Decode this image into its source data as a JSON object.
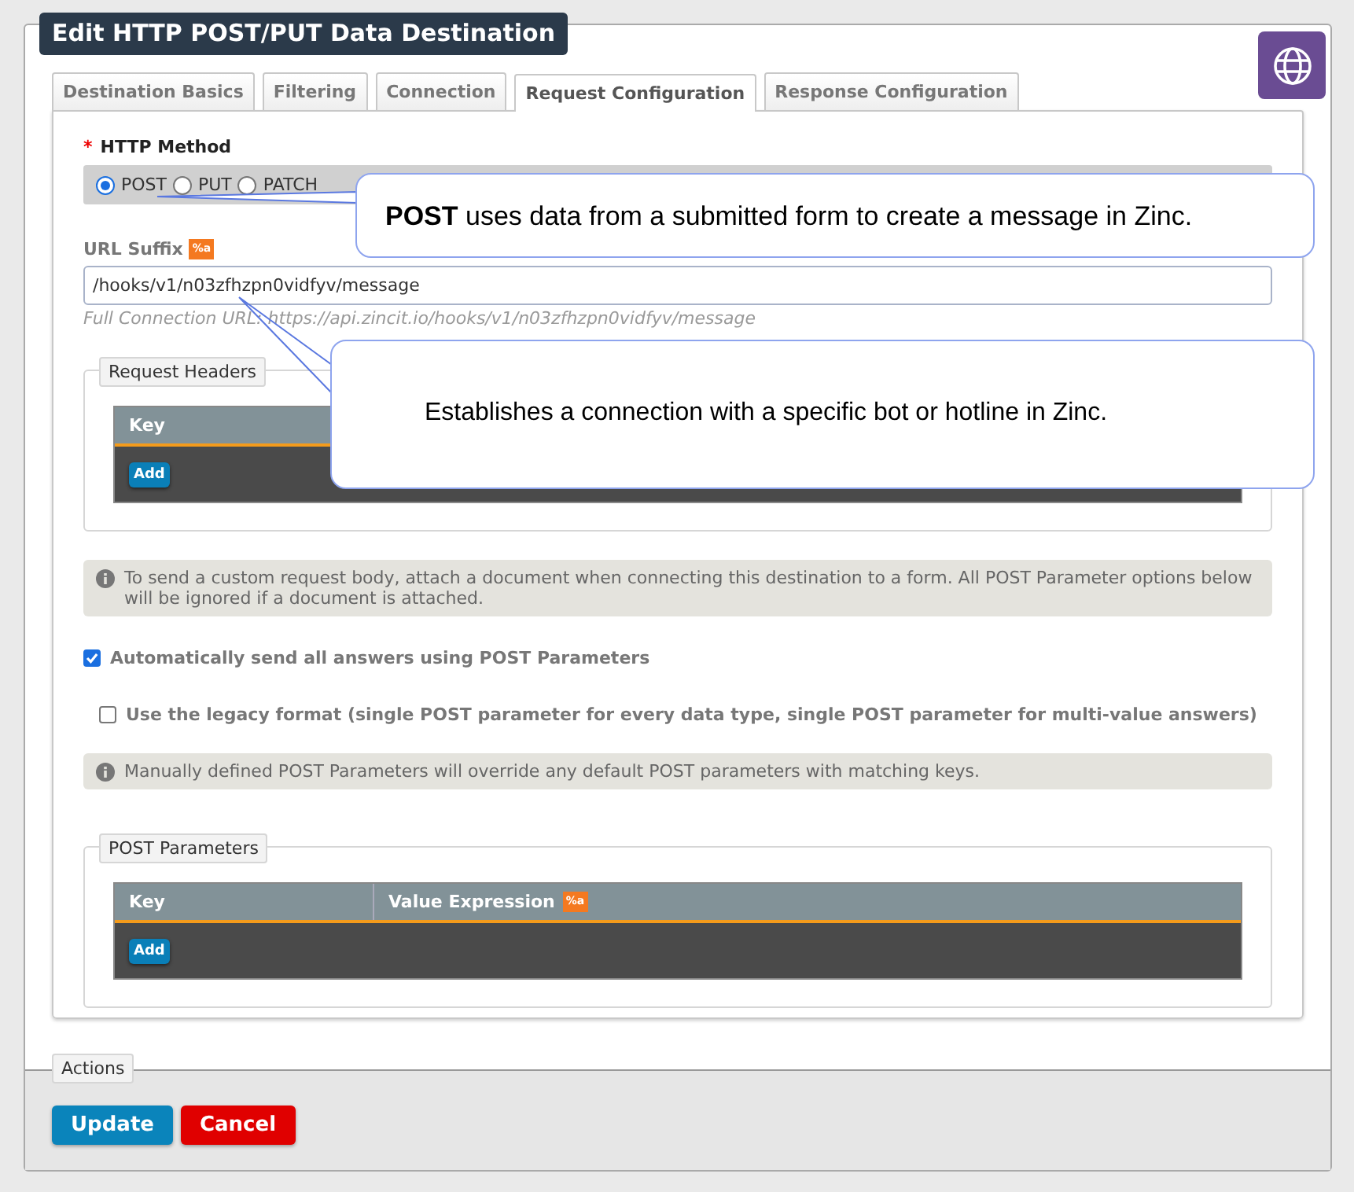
{
  "dialog": {
    "title": "Edit HTTP POST/PUT Data Destination"
  },
  "tabs": [
    {
      "label": "Destination Basics",
      "selected": false
    },
    {
      "label": "Filtering",
      "selected": false
    },
    {
      "label": "Connection",
      "selected": false
    },
    {
      "label": "Request Configuration",
      "selected": true
    },
    {
      "label": "Response Configuration",
      "selected": false
    }
  ],
  "http_method": {
    "required_mark": "*",
    "label": "HTTP Method",
    "options": [
      {
        "label": "POST",
        "selected": true
      },
      {
        "label": "PUT",
        "selected": false
      },
      {
        "label": "PATCH",
        "selected": false
      }
    ]
  },
  "url_suffix": {
    "label": "URL Suffix",
    "badge": "%a",
    "value": "/hooks/v1/n03zfhzpn0vidfyv/message",
    "hint": "Full Connection URL: https://api.zincit.io/hooks/v1/n03zfhzpn0vidfyv/message"
  },
  "request_headers": {
    "legend": "Request Headers",
    "columns": [
      {
        "label": "Key"
      }
    ],
    "add_button": "Add"
  },
  "body_note": "To send a custom request body, attach a document when connecting this destination to a form. All POST Parameter options below will be ignored if a document is attached.",
  "options": [
    {
      "label": "Automatically send all answers using POST Parameters",
      "checked": true,
      "children": [
        {
          "label": "Use the legacy format (single POST parameter for every data type, single POST parameter for multi-value answers)",
          "checked": false
        }
      ]
    }
  ],
  "override_note": "Manually defined POST Parameters will override any default POST parameters with matching keys.",
  "post_parameters": {
    "legend": "POST Parameters",
    "columns": [
      {
        "label": "Key"
      },
      {
        "label": "Value Expression",
        "badge": "%a"
      }
    ],
    "add_button": "Add"
  },
  "actions": {
    "legend": "Actions",
    "buttons": [
      {
        "label": "Update",
        "kind": "primary"
      },
      {
        "label": "Cancel",
        "kind": "danger"
      }
    ]
  },
  "callouts": [
    {
      "text": "**POST** uses data from a submitted form to create a message in Zinc."
    },
    {
      "text": "Establishes a connection with a specific bot or hotline in Zinc."
    }
  ]
}
